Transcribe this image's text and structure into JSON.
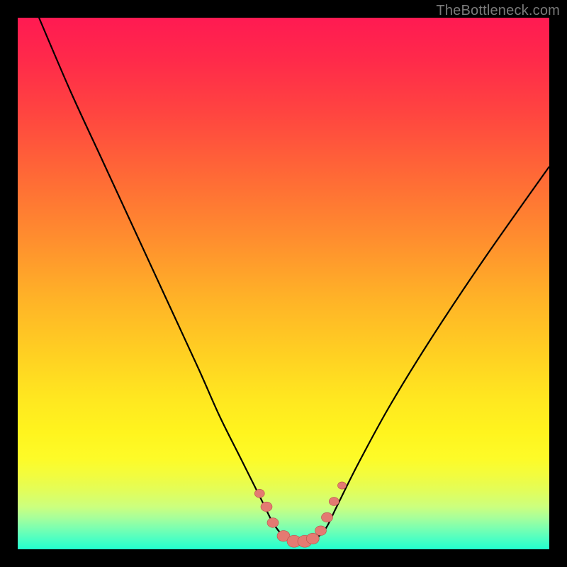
{
  "watermark": "TheBottleneck.com",
  "colors": {
    "frame": "#000000",
    "curve_stroke": "#000000",
    "marker_fill": "#e47a72",
    "marker_stroke": "#b84f48",
    "watermark": "#7a7a7a"
  },
  "chart_data": {
    "type": "line",
    "title": "",
    "xlabel": "",
    "ylabel": "",
    "xlim": [
      0,
      100
    ],
    "ylim": [
      0,
      100
    ],
    "grid": false,
    "legend": false,
    "series": [
      {
        "name": "bottleneck-curve",
        "x": [
          4,
          10,
          16,
          22,
          28,
          34,
          38,
          42,
          46,
          48,
          50,
          52,
          54,
          56,
          58,
          60,
          64,
          70,
          78,
          88,
          100
        ],
        "y": [
          100,
          86,
          73,
          60,
          47,
          34,
          25,
          17,
          9,
          5,
          2.5,
          1.5,
          1.5,
          2,
          4,
          8,
          16,
          27,
          40,
          55,
          72
        ]
      }
    ],
    "markers": {
      "name": "threshold-markers",
      "x": [
        45.5,
        46.8,
        48.0,
        50.0,
        52.0,
        54.0,
        55.5,
        57.0,
        58.2,
        59.5,
        61.0
      ],
      "y": [
        10.5,
        8.0,
        5.0,
        2.5,
        1.5,
        1.5,
        2.0,
        3.5,
        6.0,
        9.0,
        12.0
      ],
      "sizes": [
        7,
        8,
        8,
        9,
        10,
        10,
        9,
        8,
        8,
        7,
        6
      ]
    }
  }
}
